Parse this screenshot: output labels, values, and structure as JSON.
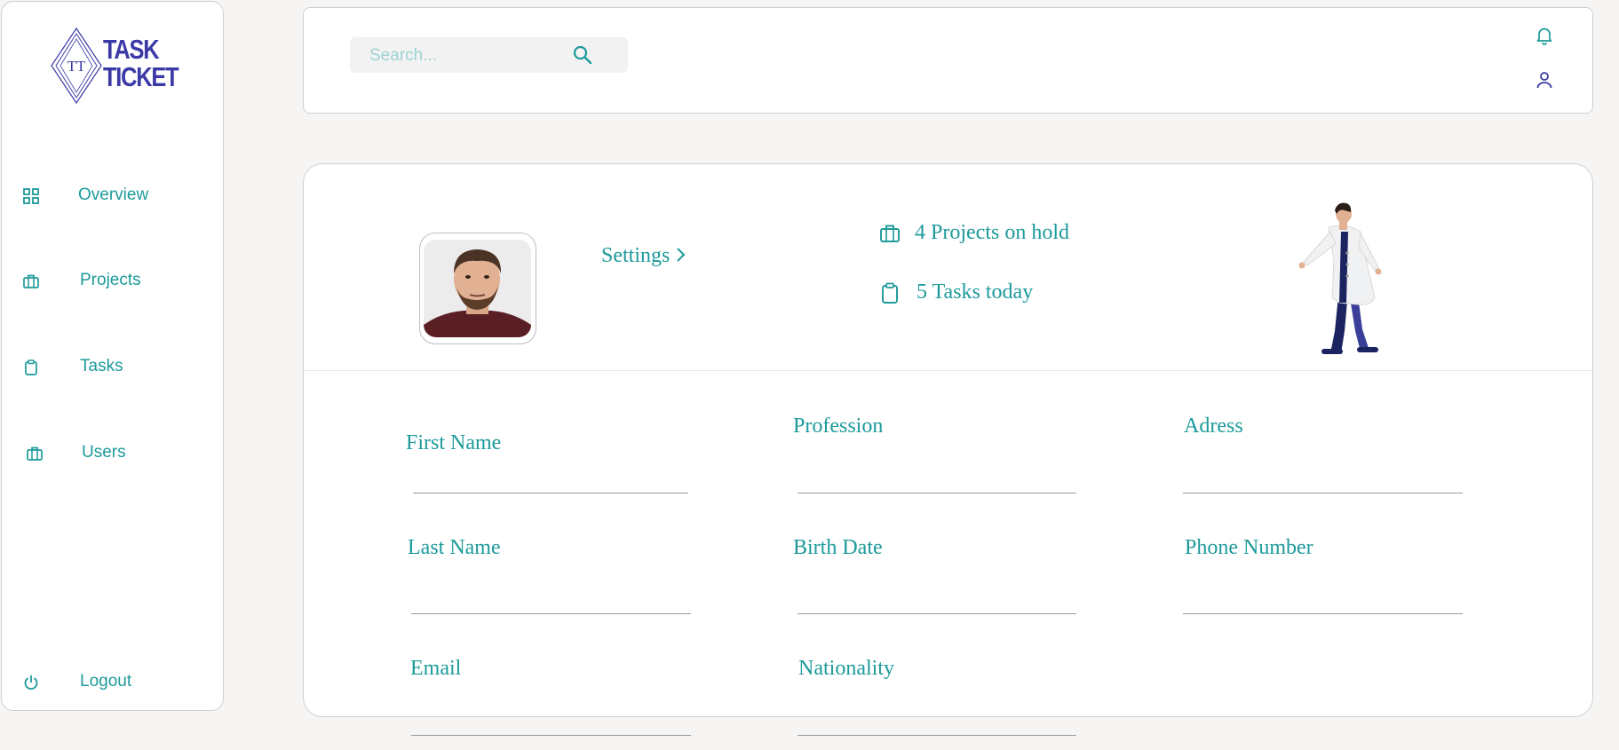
{
  "brand": {
    "logo_monogram": "TT",
    "logo_line1": "TASK",
    "logo_line2": "TICKET"
  },
  "sidebar": {
    "items": [
      {
        "label": "Overview",
        "icon": "grid-icon"
      },
      {
        "label": "Projects",
        "icon": "briefcase-icon"
      },
      {
        "label": "Tasks",
        "icon": "clipboard-icon"
      },
      {
        "label": "Users",
        "icon": "briefcase-icon"
      }
    ],
    "logout": {
      "label": "Logout",
      "icon": "power-icon"
    }
  },
  "header": {
    "search": {
      "placeholder": "Search...",
      "value": "",
      "icon": "search-icon"
    },
    "icons": [
      "bell-icon",
      "user-icon"
    ]
  },
  "profile": {
    "settings_label": "Settings",
    "stats": [
      {
        "text": "4 Projects on hold",
        "icon": "briefcase-icon"
      },
      {
        "text": "5 Tasks today",
        "icon": "clipboard-icon"
      }
    ]
  },
  "form": {
    "fields": {
      "first_name": "First Name",
      "last_name": "Last Name",
      "email": "Email",
      "profession": "Profession",
      "birth_date": "Birth Date",
      "nationality": "Nationality",
      "address": "Adress",
      "phone": "Phone Number"
    }
  },
  "colors": {
    "accent": "#1d9a9a",
    "brand": "#3b3aa6",
    "background": "#f6f5f3",
    "border": "#cfcfcf"
  }
}
